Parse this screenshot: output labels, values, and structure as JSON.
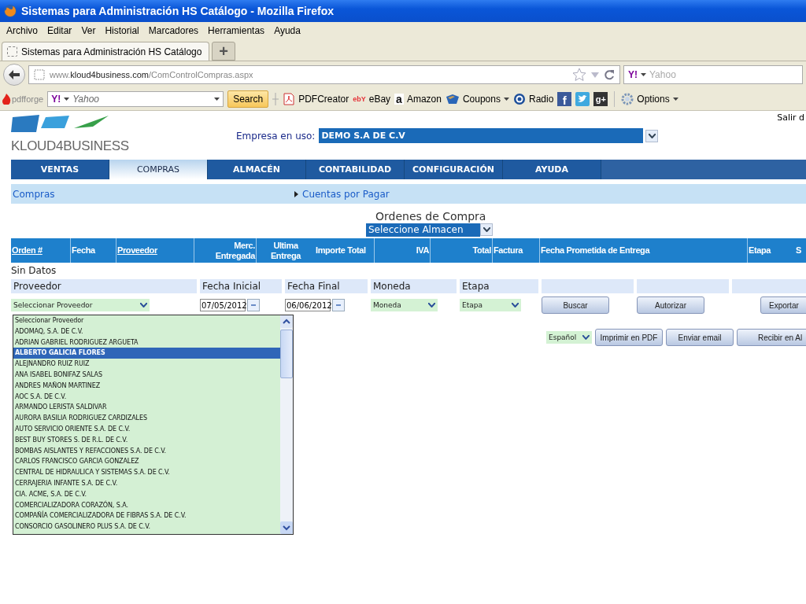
{
  "browser": {
    "title": "Sistemas para Administración HS Catálogo - Mozilla Firefox",
    "menu": [
      "Archivo",
      "Editar",
      "Ver",
      "Historial",
      "Marcadores",
      "Herramientas",
      "Ayuda"
    ],
    "tabs": [
      {
        "label": "Sistemas para Administración HS Catálogo",
        "selected": true
      }
    ],
    "new_tab": "+",
    "url": "www.**kloud4business.com**/ComControlCompras.aspx",
    "search": {
      "logo": "Y!",
      "placeholder": "Yahoo"
    },
    "toolbar": {
      "brand": "pdfforge",
      "search_logo": "Y!",
      "search_placeholder": "Yahoo",
      "search_button": "Search",
      "items": [
        {
          "kind": "pdf",
          "label": "PDFCreator"
        },
        {
          "kind": "ebay",
          "glyph": "ebY",
          "label": "eBay"
        },
        {
          "kind": "amazon",
          "glyph": "a",
          "label": "Amazon"
        },
        {
          "kind": "coupons",
          "label": "Coupons",
          "menu": true
        },
        {
          "kind": "radio",
          "label": "Radio"
        },
        {
          "kind": "facebook",
          "glyph": "f"
        },
        {
          "kind": "twitter"
        },
        {
          "kind": "gplus",
          "glyph": "g+"
        },
        {
          "kind": "options",
          "label": "Options",
          "menu": true
        }
      ]
    }
  },
  "app": {
    "logo_text": "KLOUD4BUSINESS",
    "logout": "Salir d",
    "company_label": "Empresa en uso:",
    "company_value": "DEMO S.A DE C.V",
    "nav": [
      {
        "label": "VENTAS",
        "selected": false
      },
      {
        "label": "COMPRAS",
        "selected": true
      },
      {
        "label": "ALMACÉN",
        "selected": false
      },
      {
        "label": "CONTABILIDAD",
        "selected": false
      },
      {
        "label": "CONFIGURACIÓN",
        "selected": false
      },
      {
        "label": "AYUDA",
        "selected": false
      }
    ],
    "submenu": {
      "section": "Compras",
      "link": "Cuentas por Pagar"
    },
    "title": "Ordenes de Compra",
    "warehouse": "Seleccione Almacen",
    "table": {
      "columns": [
        {
          "label": "Orden #",
          "link": true
        },
        {
          "label": "Fecha",
          "link": false
        },
        {
          "label": "Proveedor",
          "link": true
        },
        {
          "label": "Merc. Entregada",
          "link": false
        },
        {
          "label": "Ultima Entrega",
          "link": false
        },
        {
          "label": "Importe Total",
          "link": false
        },
        {
          "label": "IVA",
          "link": false
        },
        {
          "label": "Total",
          "link": false
        },
        {
          "label": "Factura",
          "link": false
        },
        {
          "label": "Fecha Prometida de Entrega",
          "link": false
        },
        {
          "label": "Etapa",
          "link": false
        },
        {
          "label": "S",
          "link": false
        }
      ],
      "empty_text": "Sin Datos"
    },
    "filter_labels": [
      {
        "kind": "label",
        "label": "Proveedor"
      },
      {
        "kind": "label",
        "label": "Fecha Inicial"
      },
      {
        "kind": "label",
        "label": "Fecha Final"
      },
      {
        "kind": "label",
        "label": "Moneda"
      },
      {
        "kind": "label",
        "label": "Etapa"
      },
      {
        "kind": "blank"
      },
      {
        "kind": "blank"
      },
      {
        "kind": "blank"
      }
    ],
    "filter_controls": [
      {
        "kind": "select",
        "value": "Seleccionar Proveedor"
      },
      {
        "kind": "date",
        "value": "07/05/2012"
      },
      {
        "kind": "date",
        "value": "06/06/2012"
      },
      {
        "kind": "select",
        "value": "Moneda"
      },
      {
        "kind": "select",
        "value": "Etapa"
      },
      {
        "kind": "button",
        "label": "Buscar"
      },
      {
        "kind": "button",
        "label": "Autorizar"
      },
      {
        "kind": "button",
        "label": "Exportar"
      }
    ],
    "actions": [
      {
        "kind": "select",
        "value": "Español"
      },
      {
        "kind": "button",
        "label": "Imprimir en PDF"
      },
      {
        "kind": "button",
        "label": "Enviar email"
      },
      {
        "kind": "button",
        "label": "Recibir en Al"
      }
    ],
    "dropdown": [
      {
        "label": "Seleccionar Proveedor",
        "selected": false
      },
      {
        "label": "ADOMAQ, S.A. DE C.V.",
        "selected": false
      },
      {
        "label": "ADRIAN GABRIEL RODRIGUEZ ARGUETA",
        "selected": false
      },
      {
        "label": "ALBERTO GALICIA FLORES",
        "selected": true
      },
      {
        "label": "ALEJNANDRO RUIZ RUIZ",
        "selected": false
      },
      {
        "label": "ANA ISABEL BONIFAZ SALAS",
        "selected": false
      },
      {
        "label": "ANDRES MAÑON MARTINEZ",
        "selected": false
      },
      {
        "label": "AOC S.A. DE C.V.",
        "selected": false
      },
      {
        "label": "ARMANDO LERISTA SALDIVAR",
        "selected": false
      },
      {
        "label": "AURORA BASILIA RODRIGUEZ CARDIZALES",
        "selected": false
      },
      {
        "label": "AUTO SERVICIO ORIENTE S.A. DE C.V.",
        "selected": false
      },
      {
        "label": "BEST BUY STORES S. DE R.L. DE C.V.",
        "selected": false
      },
      {
        "label": "BOMBAS AISLANTES Y REFACCIONES S.A. DE C.V.",
        "selected": false
      },
      {
        "label": "CARLOS FRANCISCO GARCIA GONZALEZ",
        "selected": false
      },
      {
        "label": "CENTRAL DE HIDRAULICA Y SISTEMAS S.A. DE C.V.",
        "selected": false
      },
      {
        "label": "CERRAJERIA INFANTE S.A. DE C.V.",
        "selected": false
      },
      {
        "label": "CIA. ACME, S.A. DE C.V.",
        "selected": false
      },
      {
        "label": "COMERCIALIZADORA CORAZÓN, S.A.",
        "selected": false
      },
      {
        "label": "COMPAÑÍA COMERCIALIZADORA DE FIBRAS S.A. DE C.V.",
        "selected": false
      },
      {
        "label": "CONSORCIO GASOLINERO PLUS S.A. DE C.V.",
        "selected": false
      }
    ]
  }
}
